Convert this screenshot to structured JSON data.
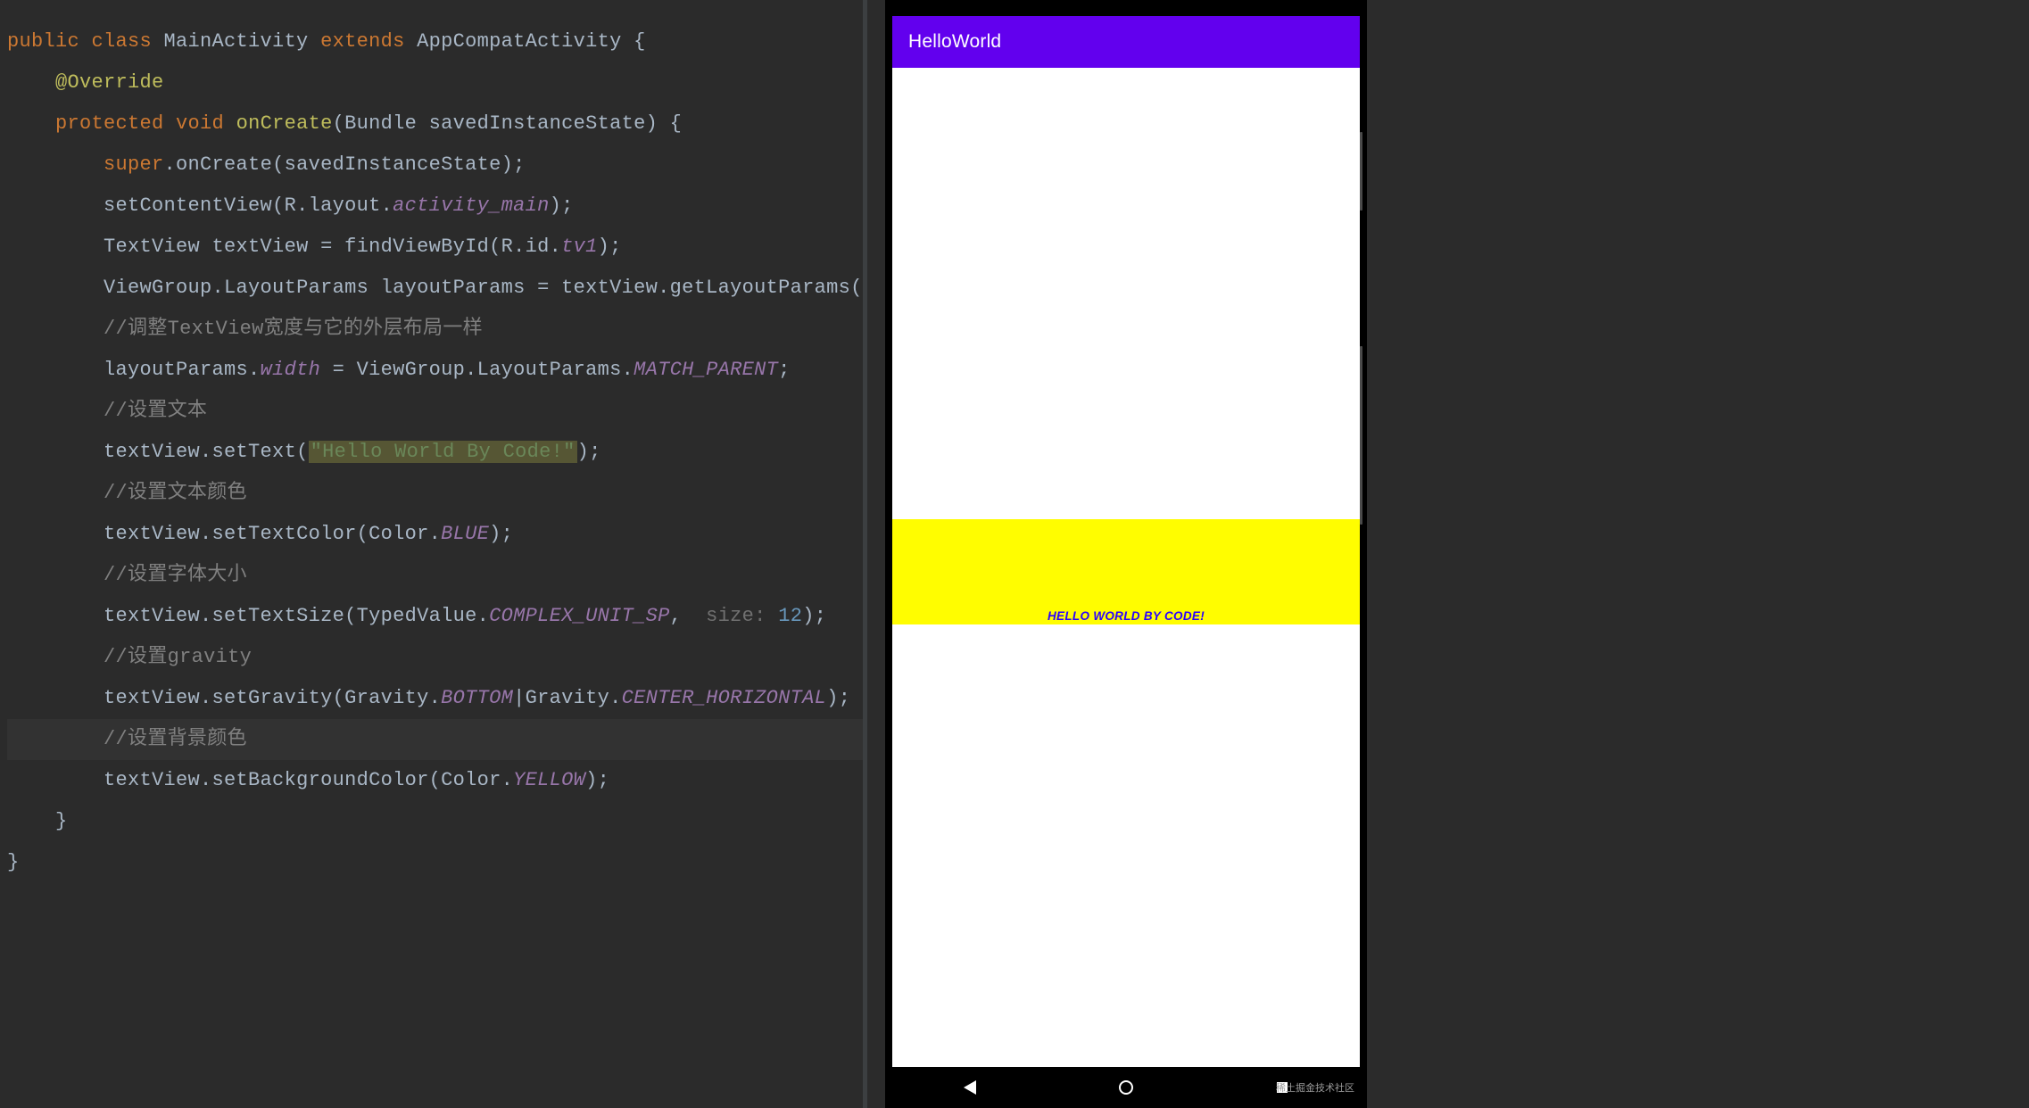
{
  "code": {
    "l1_public": "public",
    "l1_class": " class",
    "l1_name": " MainActivity",
    "l1_extends": " extends",
    "l1_rest": " AppCompatActivity {",
    "blank": "",
    "l3_ind": "    ",
    "l3_annot": "@Override",
    "l4_ind": "    ",
    "l4_protected": "protected",
    "l4_void": " void",
    "l4_method": " onCreate",
    "l4_rest": "(Bundle savedInstanceState) {",
    "l5_ind": "        ",
    "l5_super": "super",
    "l5_rest": ".onCreate(savedInstanceState);",
    "l6_ind": "        ",
    "l6_a": "setContentView(R.layout.",
    "l6_field": "activity_main",
    "l6_b": ");",
    "l7_ind": "        ",
    "l7_a": "TextView textView = findViewById(R.id.",
    "l7_field": "tv1",
    "l7_b": ");",
    "l8_ind": "        ",
    "l8_a": "ViewGroup.LayoutParams layoutParams = textView.getLayoutParams();",
    "l9_ind": "        ",
    "l9_c": "//调整TextView宽度与它的外层布局一样",
    "l10_ind": "        ",
    "l10_a": "layoutParams.",
    "l10_field": "width",
    "l10_b": " = ViewGroup.LayoutParams.",
    "l10_const": "MATCH_PARENT",
    "l10_c": ";",
    "l11_ind": "        ",
    "l11_c": "//设置文本",
    "l12_ind": "        ",
    "l12_a": "textView.setText(",
    "l12_str": "\"Hello World By Code!\"",
    "l12_b": ");",
    "l13_ind": "        ",
    "l13_c": "//设置文本颜色",
    "l14_ind": "        ",
    "l14_a": "textView.setTextColor(Color.",
    "l14_const": "BLUE",
    "l14_b": ");",
    "l15_ind": "        ",
    "l15_c": "//设置字体大小",
    "l16_ind": "        ",
    "l16_a": "textView.setTextSize(TypedValue.",
    "l16_const": "COMPLEX_UNIT_SP",
    "l16_b": ", ",
    "l16_pname": " size: ",
    "l16_num": "12",
    "l16_c": ");",
    "l17_ind": "        ",
    "l17_c": "//设置gravity",
    "l18_ind": "        ",
    "l18_a": "textView.setGravity(Gravity.",
    "l18_const1": "BOTTOM",
    "l18_mid": "|Gravity.",
    "l18_const2": "CENTER_HORIZONTAL",
    "l18_b": ");",
    "l19_ind": "        ",
    "l19_c": "//设置背景颜色",
    "l20_ind": "        ",
    "l20_a": "textView.setBackgroundColor(Color.",
    "l20_const": "YELLOW",
    "l20_b": ");",
    "l21": "    }",
    "l22": "}"
  },
  "emulator": {
    "app_title": "HelloWorld",
    "textview_text": "HELLO WORLD BY CODE!",
    "watermark": "稀土掘金技术社区"
  }
}
